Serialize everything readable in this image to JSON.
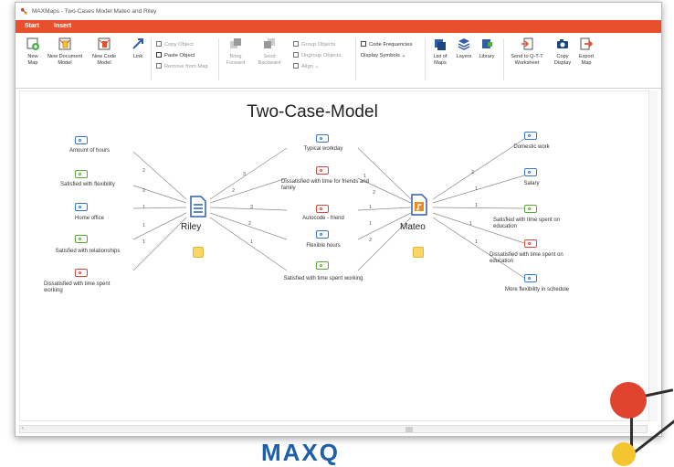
{
  "window": {
    "title": "MAXMaps - Two-Cases Model Mateo and Riley"
  },
  "ribbon_tabs": [
    {
      "label": "Start"
    },
    {
      "label": "Insert"
    }
  ],
  "toolbar": {
    "new_map": "New\nMap",
    "new_document_model": "New Document\nModel",
    "new_code_model": "New Code\nModel",
    "link": "Link",
    "copy_object": "Copy Object",
    "paste_object": "Paste Object",
    "remove_from_map": "Remove from Map",
    "bring_forward": "Bring\nForward",
    "send_backward": "Send\nBackward",
    "group_objects": "Group Objects",
    "ungroup_objects": "Ungroup Objects",
    "align": "Align",
    "code_frequencies": "Code Frequencies",
    "display_symbols": "Display Symbols",
    "list_of_maps": "List of\nMaps",
    "layers": "Layers",
    "library": "Library",
    "send_to_qtt": "Send to Q-T-T\nWorksheet",
    "copy_display": "Copy\nDisplay",
    "export_map": "Export\nMap"
  },
  "map": {
    "title": "Two-Case-Model",
    "documents": [
      {
        "name": "Riley"
      },
      {
        "name": "Mateo"
      }
    ],
    "riley_codes": [
      {
        "label": "Amount of hours",
        "color": "blue",
        "weight": "2"
      },
      {
        "label": "Satisfied with flexibility",
        "color": "green",
        "weight": "2"
      },
      {
        "label": "Home office",
        "color": "blue",
        "weight": "1"
      },
      {
        "label": "Satisfied with relationships",
        "color": "green",
        "weight": "1"
      },
      {
        "label": "Dissatisfied with time spent working",
        "color": "red",
        "weight": "1"
      }
    ],
    "shared_codes": [
      {
        "label": "Typical workday",
        "color": "blue",
        "w_riley": "3",
        "w_mateo": "1"
      },
      {
        "label": "Dissatisfied with time for friends and family",
        "color": "red",
        "w_riley": "2",
        "w_mateo": "2"
      },
      {
        "label": "Autocode - friend",
        "color": "red",
        "w_riley": "3",
        "w_mateo": "1"
      },
      {
        "label": "Flexible hours",
        "color": "blue",
        "w_riley": "2",
        "w_mateo": "1"
      },
      {
        "label": "Satisfied with time spent working",
        "color": "green",
        "w_riley": "1",
        "w_mateo": "2"
      }
    ],
    "mateo_codes": [
      {
        "label": "Domestic work",
        "color": "blue",
        "weight": "2"
      },
      {
        "label": "Salary",
        "color": "blue",
        "weight": "1"
      },
      {
        "label": "Satisfied with time spent on education",
        "color": "green",
        "weight": "1"
      },
      {
        "label": "Dissatisfied with time spent on education",
        "color": "red",
        "weight": "1"
      },
      {
        "label": "More flexibility in schedule",
        "color": "blue",
        "weight": "1"
      }
    ]
  },
  "footer_brand": "MAXQ",
  "colors": {
    "accent": "#e8502b",
    "code_blue": "#3a78c9",
    "code_green": "#5aa83a",
    "code_red": "#d34a3c",
    "memo": "#fcd664"
  }
}
